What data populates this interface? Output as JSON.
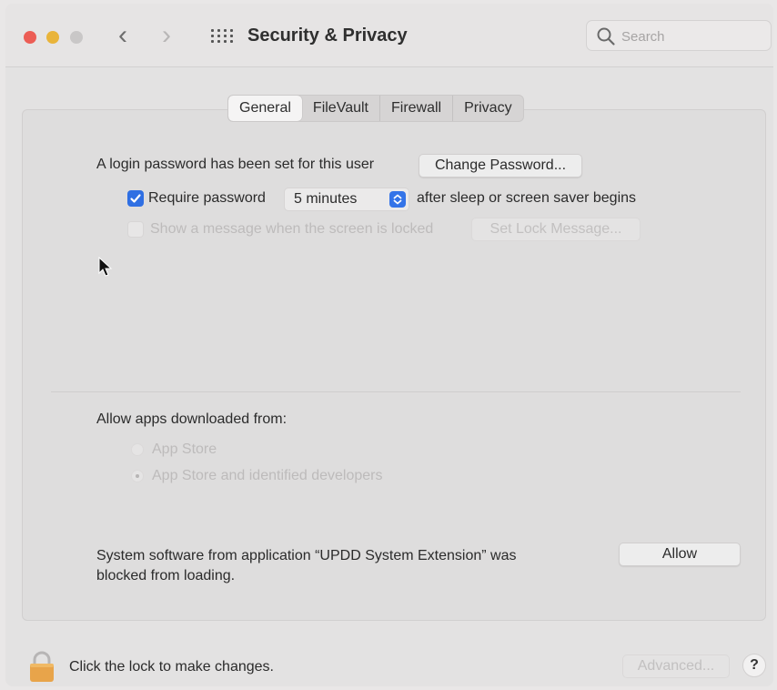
{
  "window": {
    "title": "Security & Privacy",
    "controls": [
      "close",
      "minimize",
      "zoom"
    ]
  },
  "toolbar": {
    "back_icon": "chevron-left-icon",
    "forward_icon": "chevron-right-icon",
    "back_glyph": "‹",
    "forward_glyph": "›",
    "grid_icon": "show-all-grid-icon"
  },
  "search": {
    "placeholder": "Search",
    "value": ""
  },
  "tabs": [
    {
      "label": "General",
      "active": true
    },
    {
      "label": "FileVault",
      "active": false
    },
    {
      "label": "Firewall",
      "active": false
    },
    {
      "label": "Privacy",
      "active": false
    }
  ],
  "general": {
    "login_password_text": "A login password has been set for this user",
    "change_password_label": "Change Password...",
    "require_password": {
      "checked": true,
      "label": "Require password",
      "select_value": "5 minutes",
      "suffix": "after sleep or screen saver begins"
    },
    "show_message": {
      "checked": false,
      "label": "Show a message when the screen is locked",
      "button_label": "Set Lock Message...",
      "enabled": false
    }
  },
  "allow_apps": {
    "heading": "Allow apps downloaded from:",
    "options": [
      {
        "label": "App Store",
        "selected": false
      },
      {
        "label": "App Store and identified developers",
        "selected": true
      }
    ],
    "enabled": false
  },
  "blocked": {
    "message_line1": "System software from application “UPDD System Extension” was",
    "message_line2": "blocked from loading.",
    "allow_label": "Allow"
  },
  "footer": {
    "lock_text": "Click the lock to make changes.",
    "lock_icon": "lock-icon",
    "advanced_label": "Advanced...",
    "help_label": "?"
  },
  "colors": {
    "accent": "#2f6fe3",
    "close": "#ec5d55",
    "minimize": "#e9b43a",
    "zoom_disabled": "#c9c7c7",
    "lock": "#e8a44a"
  }
}
